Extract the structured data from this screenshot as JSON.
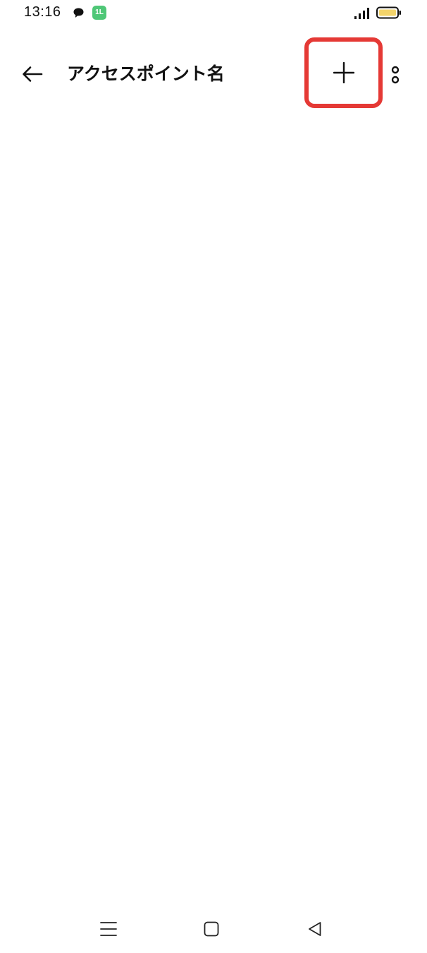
{
  "status_bar": {
    "time": "13:16",
    "icons": [
      "chat-bubble-icon",
      "app-notification-icon",
      "signal-icon",
      "battery-icon"
    ],
    "app_icon_text": "1L",
    "battery_color": "#f3d46b"
  },
  "app_bar": {
    "title": "アクセスポイント名",
    "back_icon": "arrow-left-icon",
    "add_icon": "plus-icon",
    "more_icon": "more-vertical-icon",
    "highlight_color": "#e53935"
  },
  "nav_bar": {
    "icons": [
      "menu-icon",
      "home-icon",
      "back-triangle-icon"
    ]
  }
}
